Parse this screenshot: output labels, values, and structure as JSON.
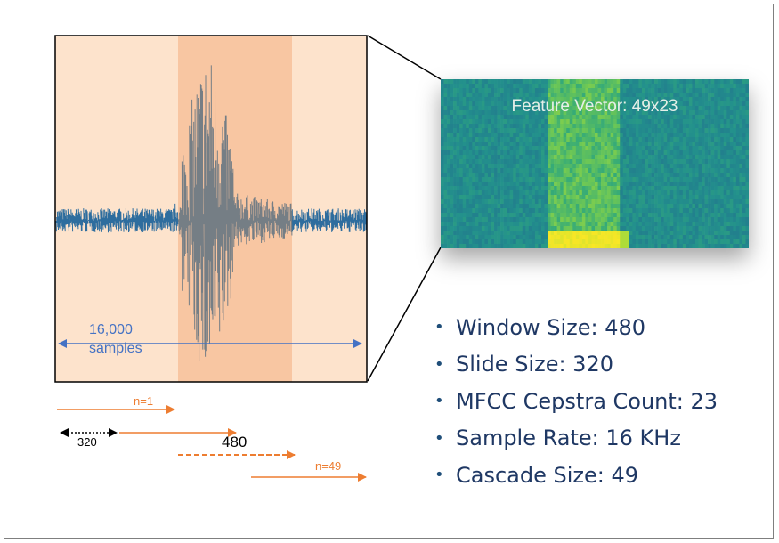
{
  "waveform": {
    "span_label_value": "16,000",
    "span_label_unit": "samples",
    "colors": {
      "background": "#fde3cc",
      "highlight": "#f8c6a2",
      "signal": "#2e6d9e",
      "arrow": "#4472c4"
    }
  },
  "spectrogram": {
    "label": "Feature Vector: 49x23"
  },
  "windows": {
    "first_label": "n=1",
    "last_label": "n=49",
    "slide_label": "320",
    "window_label": "480",
    "color": "#ed7d31"
  },
  "specs": [
    {
      "text": "Window Size: 480"
    },
    {
      "text": "Slide Size: 320"
    },
    {
      "text": "MFCC Cepstra Count: 23"
    },
    {
      "text": "Sample Rate: 16 KHz"
    },
    {
      "text": "Cascade Size: 49"
    }
  ]
}
